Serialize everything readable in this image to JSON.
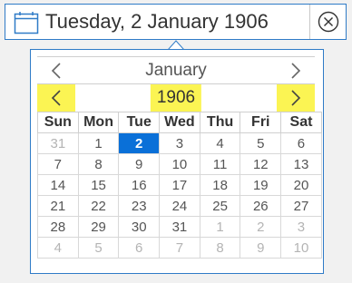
{
  "date_field": {
    "value": "Tuesday, 2 January 1906",
    "calendar_icon": "calendar-icon",
    "clear_icon": "circle-x-icon"
  },
  "calendar": {
    "month_label": "January",
    "year_label": "1906",
    "prev_month_icon": "chevron-left-icon",
    "next_month_icon": "chevron-right-icon",
    "prev_year_icon": "chevron-left-icon",
    "next_year_icon": "chevron-right-icon",
    "weekdays": [
      "Sun",
      "Mon",
      "Tue",
      "Wed",
      "Thu",
      "Fri",
      "Sat"
    ],
    "weeks": [
      [
        {
          "d": "31",
          "other": true
        },
        {
          "d": "1"
        },
        {
          "d": "2",
          "selected": true
        },
        {
          "d": "3"
        },
        {
          "d": "4"
        },
        {
          "d": "5"
        },
        {
          "d": "6"
        }
      ],
      [
        {
          "d": "7"
        },
        {
          "d": "8"
        },
        {
          "d": "9"
        },
        {
          "d": "10"
        },
        {
          "d": "11"
        },
        {
          "d": "12"
        },
        {
          "d": "13"
        }
      ],
      [
        {
          "d": "14"
        },
        {
          "d": "15"
        },
        {
          "d": "16"
        },
        {
          "d": "17"
        },
        {
          "d": "18"
        },
        {
          "d": "19"
        },
        {
          "d": "20"
        }
      ],
      [
        {
          "d": "21"
        },
        {
          "d": "22"
        },
        {
          "d": "23"
        },
        {
          "d": "24"
        },
        {
          "d": "25"
        },
        {
          "d": "26"
        },
        {
          "d": "27"
        }
      ],
      [
        {
          "d": "28"
        },
        {
          "d": "29"
        },
        {
          "d": "30"
        },
        {
          "d": "31"
        },
        {
          "d": "1",
          "other": true
        },
        {
          "d": "2",
          "other": true
        },
        {
          "d": "3",
          "other": true
        }
      ],
      [
        {
          "d": "4",
          "other": true
        },
        {
          "d": "5",
          "other": true
        },
        {
          "d": "6",
          "other": true
        },
        {
          "d": "7",
          "other": true
        },
        {
          "d": "8",
          "other": true
        },
        {
          "d": "9",
          "other": true
        },
        {
          "d": "10",
          "other": true
        }
      ]
    ]
  },
  "colors": {
    "accent_border": "#2f7bc7",
    "selected_day": "#0a70d8",
    "highlight": "#fbf453"
  }
}
